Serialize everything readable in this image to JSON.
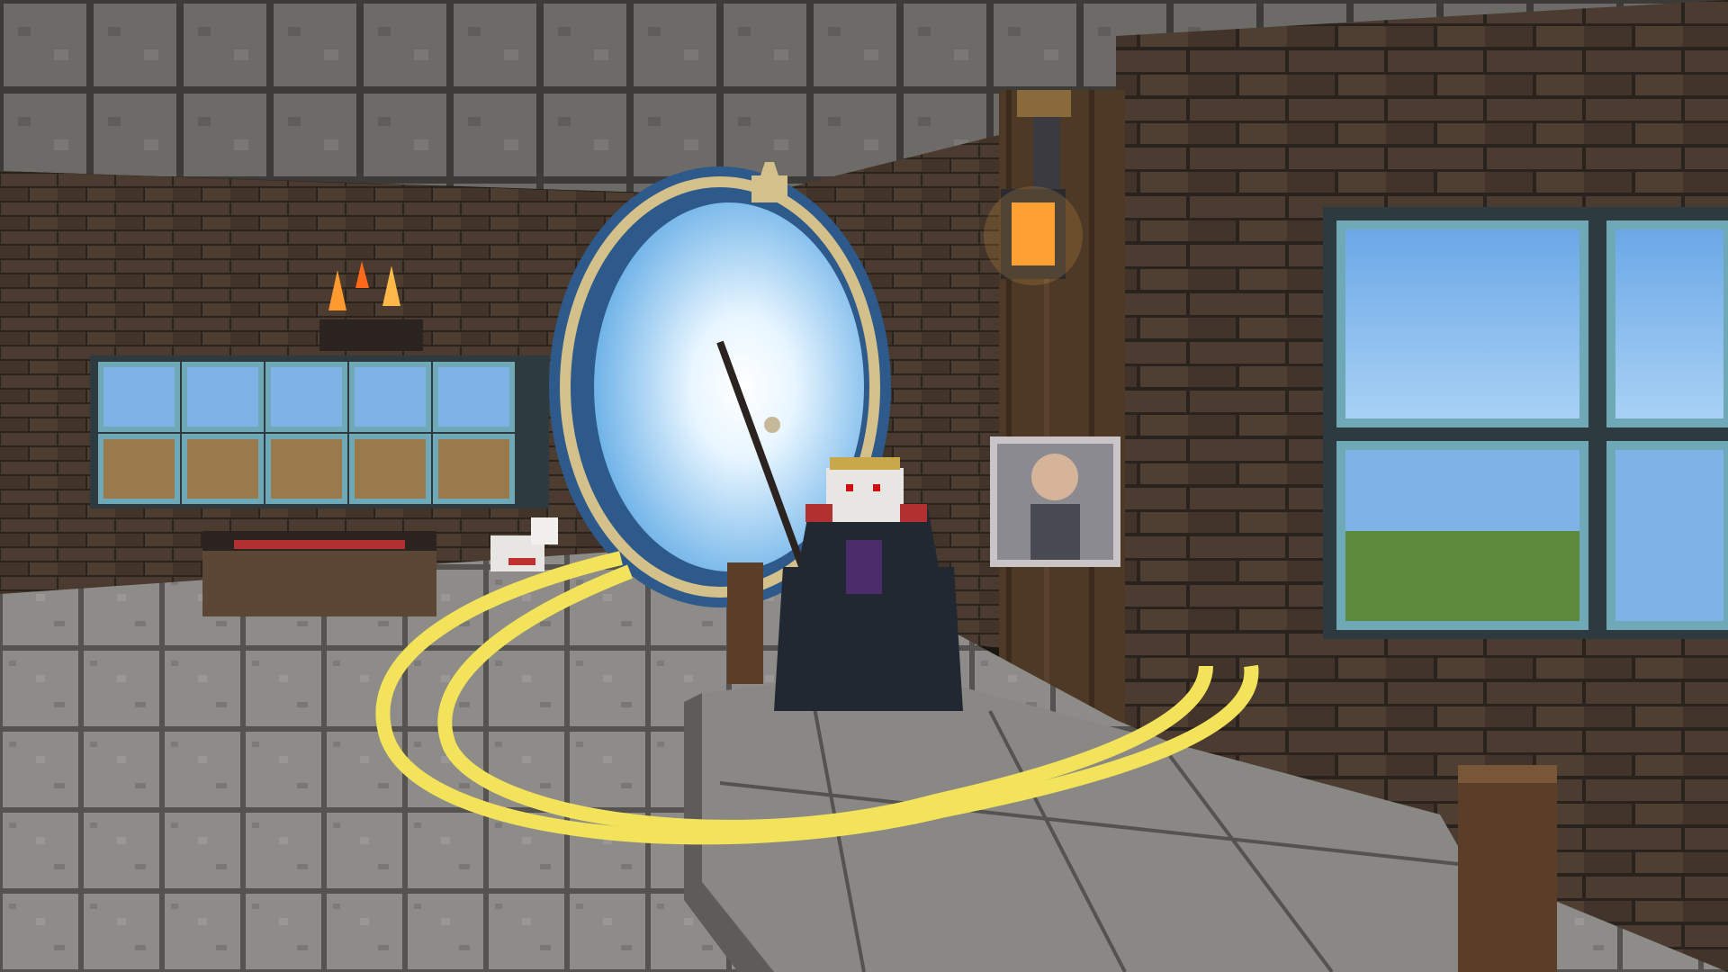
{
  "scene": {
    "palette": {
      "ceiling": "#6d6b68",
      "ceiling_seam": "#3d3b38",
      "brick": "#4a3a2f",
      "brick_mortar": "#2a221c",
      "floor": "#8e8c88",
      "floor_seam": "#55534f",
      "pillar": "#4e3826",
      "portal_glow": "#cfe9ff",
      "portal_frame": "#d4c08a",
      "portal_ring": "#2d5a8a",
      "gold_ring": "#f2e35a",
      "lantern_light": "#ff9b2e",
      "window_frame": "#6fa9b8",
      "window_sky": "#7fb3e8",
      "statue_robe": "#222831",
      "statue_gold": "#c8a84a"
    },
    "icons": {
      "lantern": "lantern-icon",
      "campfire": "campfire-icon",
      "portal": "portal-icon",
      "staff": "staff-icon",
      "dog": "dog-icon",
      "bed": "bed-icon",
      "painting": "painting-icon"
    }
  }
}
